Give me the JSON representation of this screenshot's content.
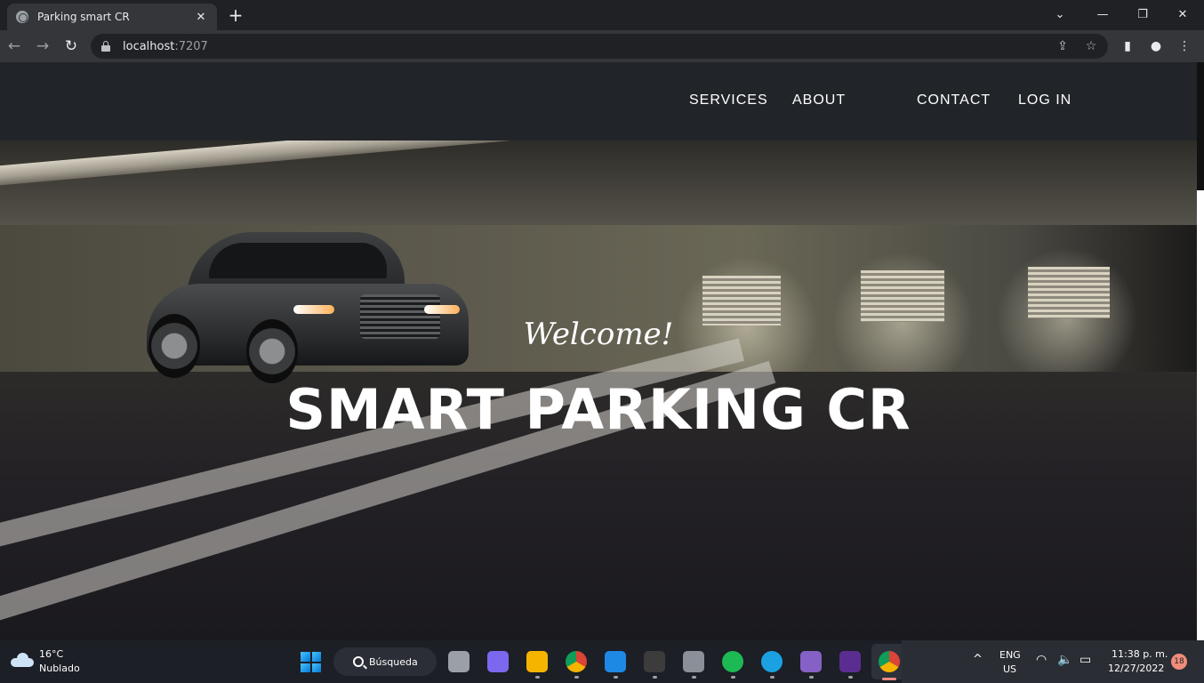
{
  "browser": {
    "tab_title": "Parking smart CR",
    "tab_close": "✕",
    "new_tab": "+",
    "url_host": "localhost",
    "url_port": ":7207",
    "window_controls": {
      "dropdown": "⌄",
      "minimize": "—",
      "restore": "❐",
      "close": "✕"
    },
    "nav": {
      "back": "←",
      "forward": "→",
      "reload": "↻"
    },
    "omni_icons": {
      "share": "⇪",
      "bookmark": "☆"
    },
    "toolbar_icons": {
      "sidepanel": "▮",
      "profile": "●",
      "menu": "⋮"
    }
  },
  "site": {
    "nav": {
      "services": "SERVICES",
      "about": "ABOUT",
      "contact": "CONTACT",
      "login": "LOG IN"
    },
    "hero": {
      "welcome": "Welcome!",
      "title": "SMART PARKING CR"
    }
  },
  "taskbar": {
    "weather": {
      "temp": "16°C",
      "desc": "Nublado"
    },
    "search_label": "Búsqueda",
    "apps": [
      {
        "name": "task-view",
        "color": "#9aa0a6"
      },
      {
        "name": "meet",
        "color": "#7b68ee"
      },
      {
        "name": "file-explorer",
        "color": "#f4b400"
      },
      {
        "name": "chrome",
        "color": "#db4437"
      },
      {
        "name": "vscode",
        "color": "#1e88e5"
      },
      {
        "name": "terminal",
        "color": "#3c3c3c"
      },
      {
        "name": "settings",
        "color": "#8a8f98"
      },
      {
        "name": "spotify",
        "color": "#1db954"
      },
      {
        "name": "edge",
        "color": "#1ba1e2"
      },
      {
        "name": "visual-studio",
        "color": "#8661c5"
      },
      {
        "name": "console",
        "color": "#5c2d91"
      },
      {
        "name": "chrome-active",
        "color": "#db4437"
      }
    ],
    "tray": {
      "chevron": "^",
      "lang": "ENG",
      "region": "US",
      "wifi": "◠",
      "volume": "🔈",
      "battery": "▭"
    },
    "clock": {
      "time": "11:38 p. m.",
      "date": "12/27/2022"
    },
    "notifications": "18"
  }
}
